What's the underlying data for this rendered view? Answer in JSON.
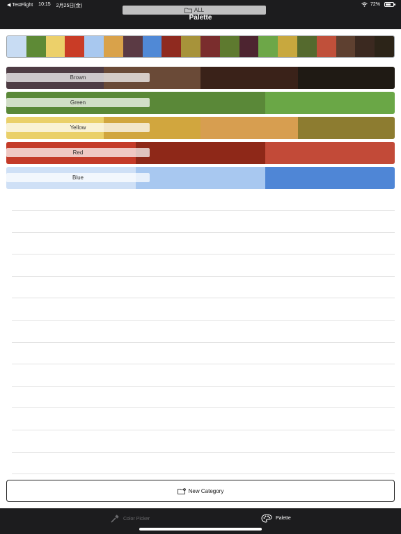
{
  "status_bar": {
    "back_app": "◀ TestFlight",
    "time": "10:15",
    "date": "2月25日(金)",
    "battery_text": "72%",
    "battery_level": 0.72,
    "icons": [
      "wifi-icon",
      "battery-icon"
    ]
  },
  "nav": {
    "title": "Palette"
  },
  "all_palette": {
    "label": "ALL",
    "icon": "folder-icon",
    "swatches": [
      "#c8dcf3",
      "#5e8a36",
      "#ecd06a",
      "#c93c26",
      "#a8c8ef",
      "#d9a24a",
      "#5b3a44",
      "#5089d6",
      "#8f2a1f",
      "#a7933a",
      "#7a2d2d",
      "#5e7a2f",
      "#4d2430",
      "#6da748",
      "#c8a83e",
      "#556a2e",
      "#c0503a",
      "#5e4030",
      "#3b2920",
      "#2c2418"
    ]
  },
  "categories": [
    {
      "label": "Brown",
      "colors": [
        "#4e3c44",
        "#6a4a37",
        "#3a2219",
        "#1f1a14"
      ]
    },
    {
      "label": "Green",
      "colors": [
        "#5a8838",
        "#5a8838",
        "#6aa746"
      ]
    },
    {
      "label": "Yellow",
      "colors": [
        "#ead06a",
        "#d1a63e",
        "#d79e50",
        "#8d7c30"
      ]
    },
    {
      "label": "Red",
      "colors": [
        "#c43a28",
        "#8e2818",
        "#c24a38"
      ]
    },
    {
      "label": "Blue",
      "colors": [
        "#cfe0f6",
        "#a8c8f0",
        "#4f86d6"
      ]
    }
  ],
  "new_category": {
    "label": "New Category",
    "icon": "folder-plus-icon"
  },
  "tabs": [
    {
      "label": "Color Picker",
      "icon": "eyedropper-icon",
      "selected": false
    },
    {
      "label": "Palette",
      "icon": "palette-icon",
      "selected": true
    }
  ]
}
